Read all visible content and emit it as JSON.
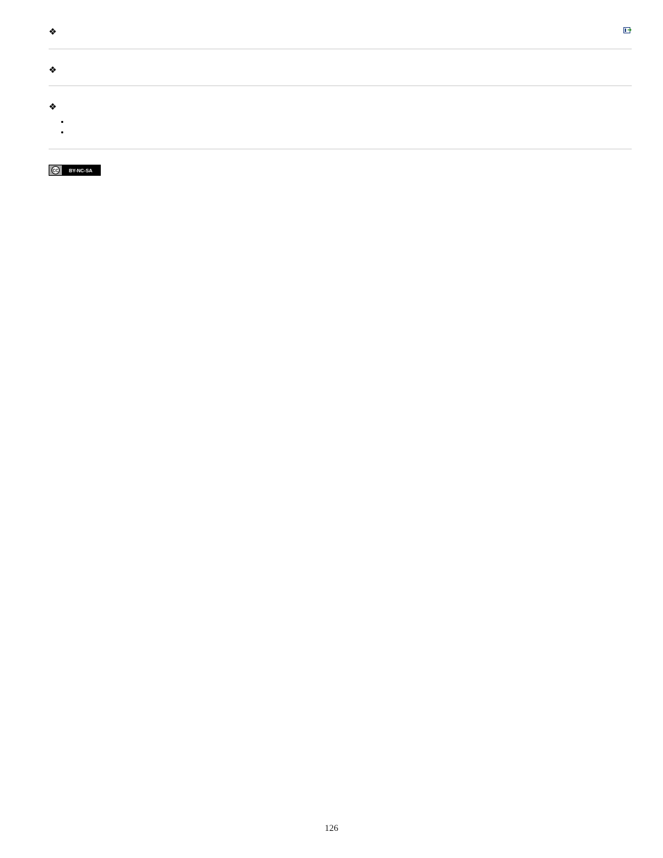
{
  "sections": [
    {
      "text": "",
      "hasIcon": true
    },
    {
      "text": ""
    },
    {
      "text": "",
      "subitems": [
        "",
        ""
      ]
    }
  ],
  "pageNumber": "126",
  "license": "BY-NC-SA"
}
